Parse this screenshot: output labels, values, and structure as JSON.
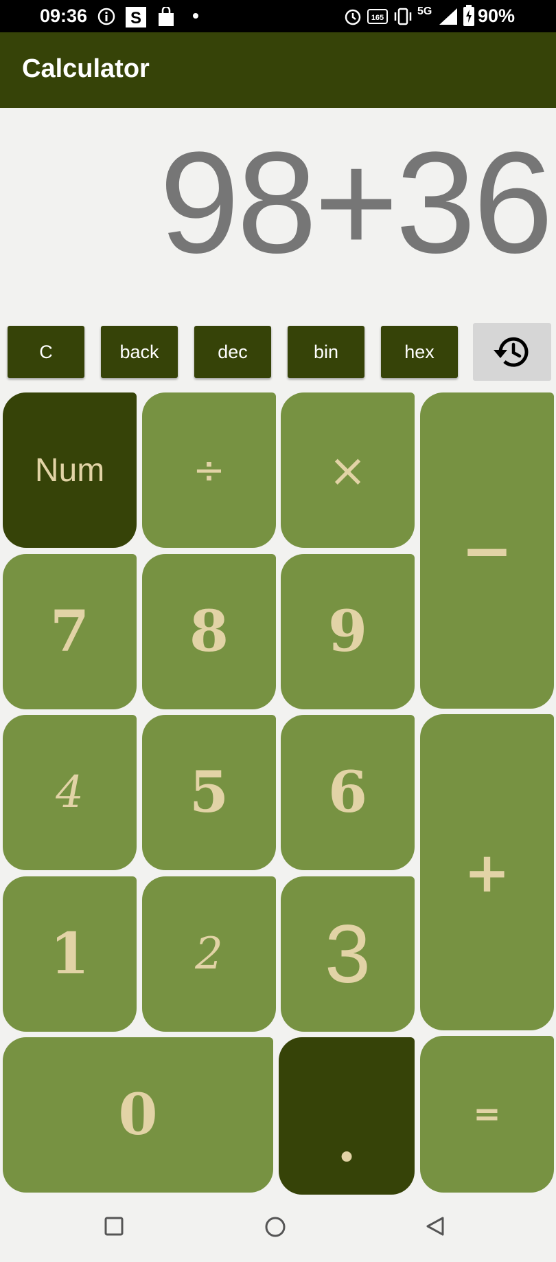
{
  "status_bar": {
    "time": "09:36",
    "battery": "90%",
    "network": "5G",
    "icons": [
      "info-icon",
      "s-app-icon",
      "shopping-bag-icon",
      "dot-icon",
      "alarm-icon",
      "refresh-rate-icon",
      "vibrate-icon",
      "signal-icon",
      "battery-icon"
    ],
    "refresh_rate": "165"
  },
  "app_bar": {
    "title": "Calculator"
  },
  "display": {
    "expression": "98+36"
  },
  "controls": {
    "clear": "C",
    "back": "back",
    "dec": "dec",
    "bin": "bin",
    "hex": "hex",
    "history_icon": "history-icon"
  },
  "keypad": {
    "num": "Num",
    "divide": "÷",
    "multiply": "×",
    "minus": "−",
    "seven": "7",
    "eight": "8",
    "nine": "9",
    "four": "4",
    "five": "5",
    "six": "6",
    "plus": "+",
    "one": "1",
    "two": "2",
    "three": "3",
    "zero": "0",
    "dot": ".",
    "equals": "="
  },
  "colors": {
    "primary": "#364308",
    "key": "#779242",
    "key_text": "#e2d3a6",
    "display_text": "#767676",
    "background": "#f2f2f0"
  },
  "nav_bar": {
    "icons": [
      "recents-icon",
      "home-icon",
      "back-icon"
    ]
  }
}
